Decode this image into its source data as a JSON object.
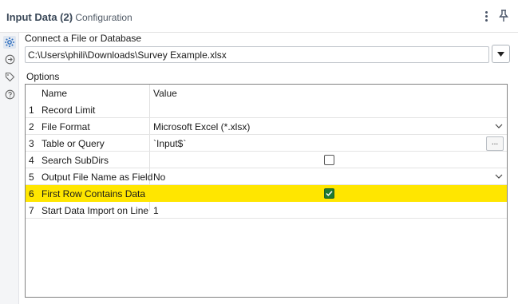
{
  "header": {
    "title": "Input Data (2)",
    "subtitle": "- Configuration"
  },
  "rail": {
    "items": [
      {
        "icon": "gear-icon",
        "active": true
      },
      {
        "icon": "connection-arrow-icon",
        "active": false
      },
      {
        "icon": "tag-icon",
        "active": false
      },
      {
        "icon": "help-icon",
        "active": false
      }
    ]
  },
  "connect": {
    "label": "Connect a File or Database",
    "path": "C:\\Users\\phili\\Downloads\\Survey Example.xlsx"
  },
  "options": {
    "label": "Options",
    "columns": {
      "name": "Name",
      "value": "Value"
    },
    "rows": [
      {
        "num": "1",
        "name": "Record Limit",
        "value": ""
      },
      {
        "num": "2",
        "name": "File Format",
        "value": "Microsoft Excel (*.xlsx)"
      },
      {
        "num": "3",
        "name": "Table or Query",
        "value": "`Input$`",
        "button": "..."
      },
      {
        "num": "4",
        "name": "Search SubDirs",
        "checked": false
      },
      {
        "num": "5",
        "name": "Output File Name as Field",
        "value": "No"
      },
      {
        "num": "6",
        "name": "First Row Contains Data",
        "checked": true
      },
      {
        "num": "7",
        "name": "Start Data Import on Line",
        "value": "1"
      }
    ]
  },
  "colors": {
    "highlight": "#ffe600",
    "checkbox_checked": "#1f7a33",
    "active_icon": "#2f6fbf"
  }
}
